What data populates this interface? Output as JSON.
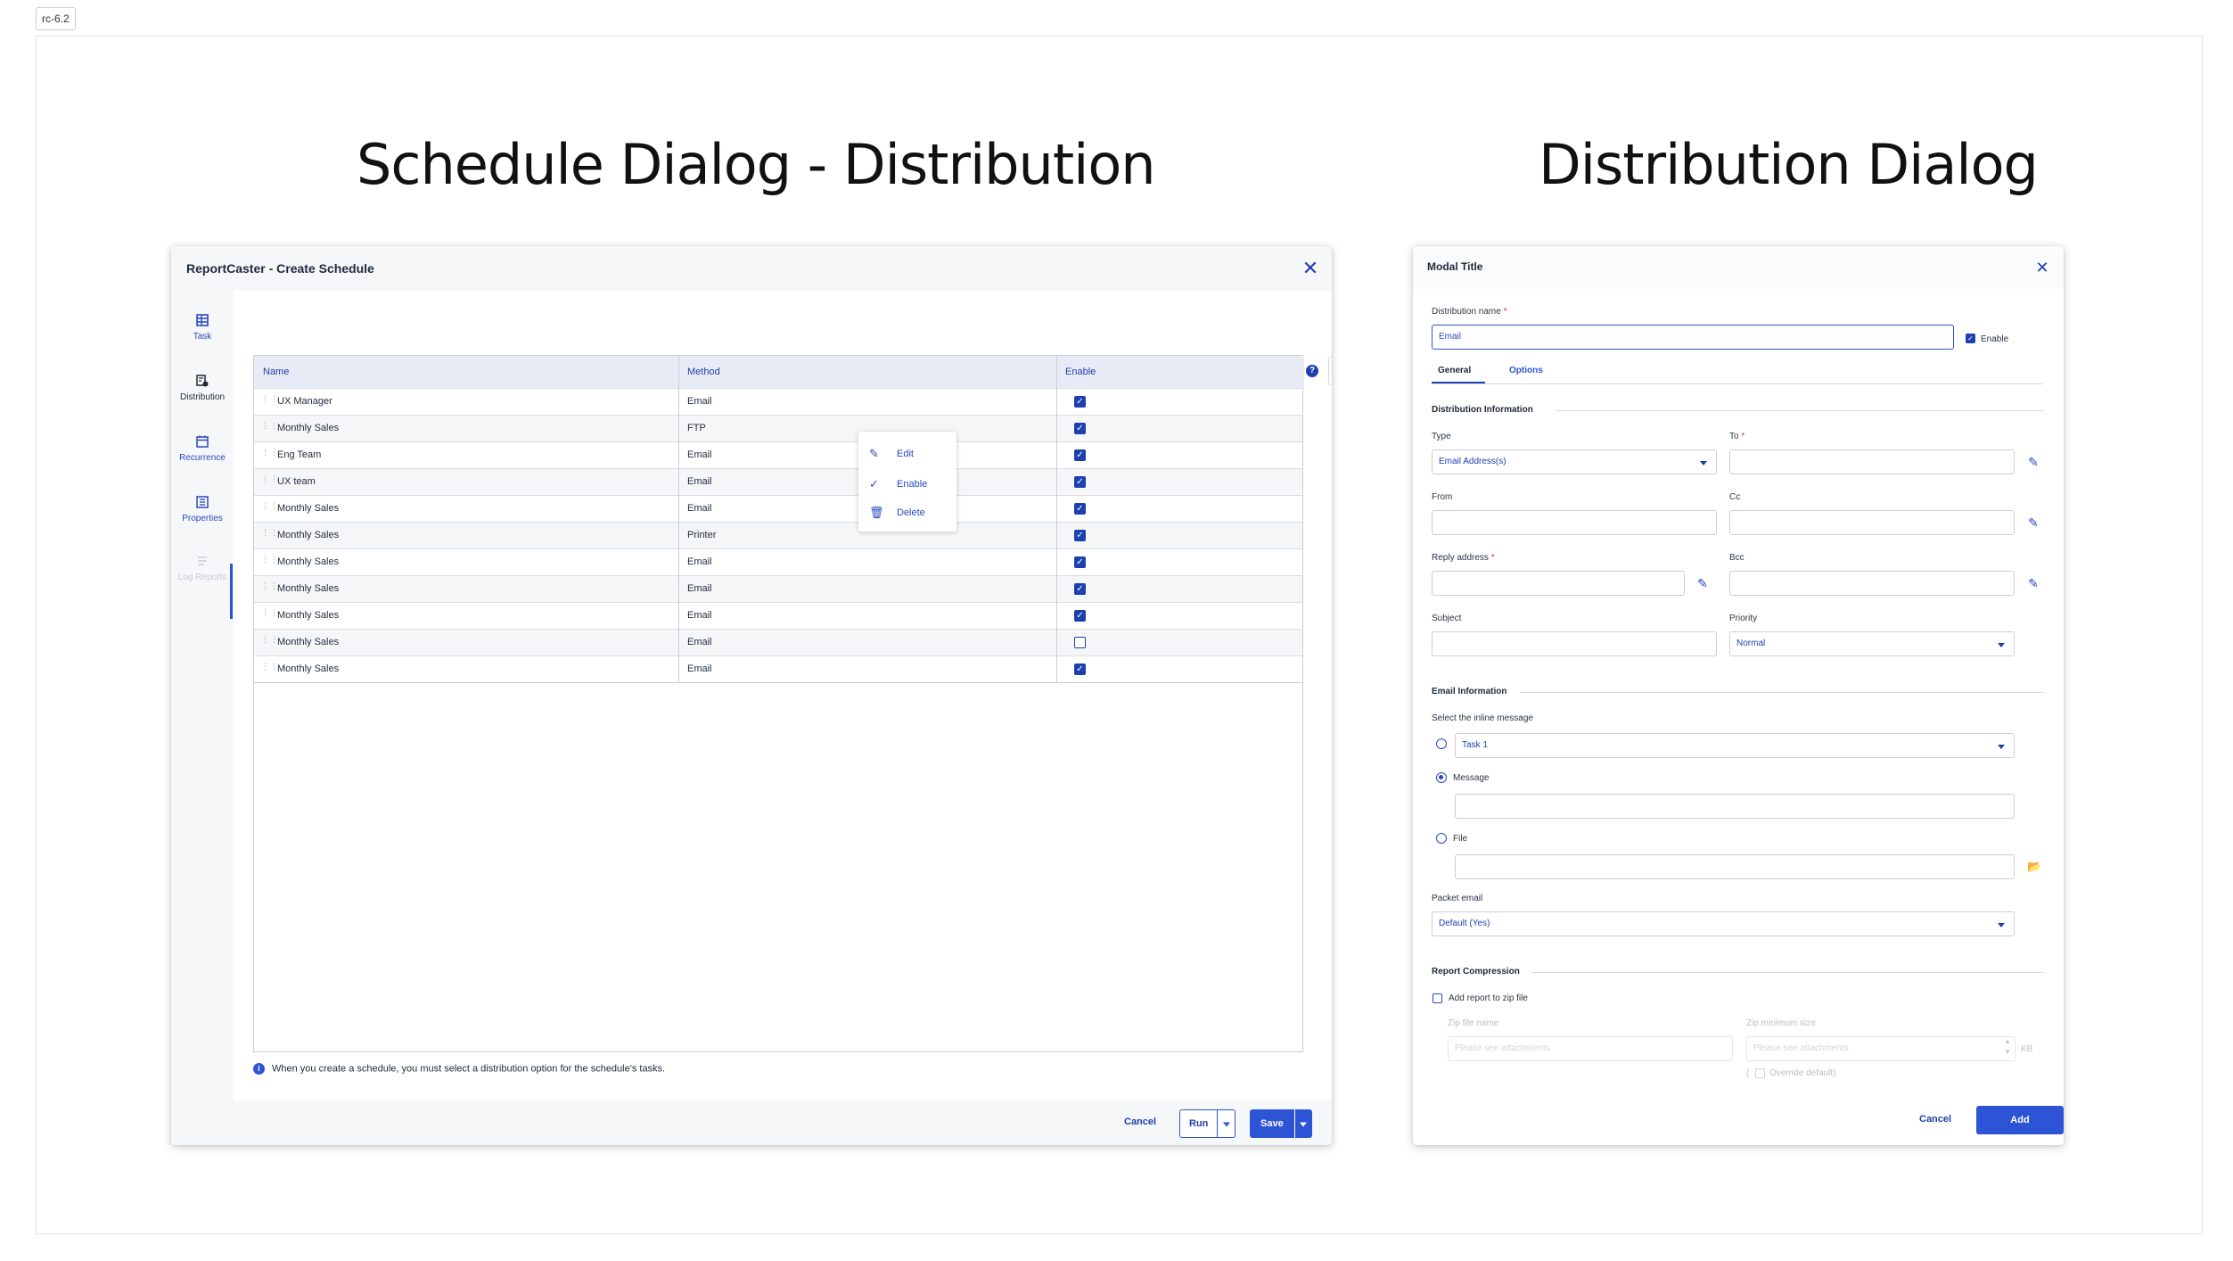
{
  "version_tag": "rc-6.2",
  "left_heading": "Schedule Dialog - Distribution",
  "right_heading": "Distribution Dialog",
  "colors": {
    "accent": "#2e54d6",
    "accent_dark": "#1e3fae",
    "required": "#d43030"
  },
  "schedule": {
    "title": "ReportCaster - Create Schedule",
    "close_icon": "close-icon",
    "sidebar": [
      {
        "label": "Task",
        "icon": "table-icon",
        "enabled": true
      },
      {
        "label": "Distribution",
        "icon": "distribution-icon",
        "enabled": true,
        "selected": true
      },
      {
        "label": "Recurrence",
        "icon": "calendar-icon",
        "enabled": true
      },
      {
        "label": "Properties",
        "icon": "properties-icon",
        "enabled": true
      },
      {
        "label": "Log Reports",
        "icon": "log-icon",
        "enabled": false
      }
    ],
    "toolbar": {
      "add": "+",
      "help": "?"
    },
    "columns": [
      "Name",
      "Method",
      "Enable"
    ],
    "rows": [
      {
        "name": "UX Manager",
        "method": "Email",
        "enabled": true
      },
      {
        "name": "Monthly Sales",
        "method": "FTP",
        "enabled": true
      },
      {
        "name": "Eng Team",
        "method": "Email",
        "enabled": true
      },
      {
        "name": "UX team",
        "method": "Email",
        "enabled": true
      },
      {
        "name": "Monthly Sales",
        "method": "Email",
        "enabled": true
      },
      {
        "name": "Monthly Sales",
        "method": "Printer",
        "enabled": true
      },
      {
        "name": "Monthly Sales",
        "method": "Email",
        "enabled": true
      },
      {
        "name": "Monthly Sales",
        "method": "Email",
        "enabled": true
      },
      {
        "name": "Monthly Sales",
        "method": "Email",
        "enabled": true
      },
      {
        "name": "Monthly Sales",
        "method": "Email",
        "enabled": false
      },
      {
        "name": "Monthly Sales",
        "method": "Email",
        "enabled": true
      }
    ],
    "context_menu": [
      {
        "label": "Edit",
        "icon": "pencil-icon"
      },
      {
        "label": "Enable",
        "icon": "check-icon"
      },
      {
        "label": "Delete",
        "icon": "trash-icon"
      }
    ],
    "info_text": "When you create a schedule, you must select a distribution option for the schedule's tasks.",
    "footer": {
      "cancel": "Cancel",
      "run": "Run",
      "save": "Save"
    }
  },
  "distribution": {
    "title": "Modal Title",
    "name_label": "Distribution name",
    "name_value": "Email",
    "enable_label": "Enable",
    "tabs": [
      "General",
      "Options"
    ],
    "distribution_info": "Distribution Information",
    "type_label": "Type",
    "type_value": "Email Address(s)",
    "to_label": "To",
    "from_label": "From",
    "cc_label": "Cc",
    "reply_label": "Reply address",
    "bcc_label": "Bcc",
    "subject_label": "Subject",
    "priority_label": "Priority",
    "priority_value": "Normal",
    "email_info": "Email Information",
    "inline_label": "Select the inline message",
    "task_value": "Task 1",
    "message_label": "Message",
    "file_label": "File",
    "packet_label": "Packet email",
    "packet_value": "Default (Yes)",
    "compression": "Report Compression",
    "zip_label": "Add report to zip file",
    "zip_name_label": "Zip file name",
    "zip_name_placeholder": "Please see attachments",
    "zip_min_label": "Zip minimum size",
    "zip_min_placeholder": "Please see attachments",
    "kb": "KB",
    "override_label": "Override default)",
    "cancel": "Cancel",
    "add": "Add"
  }
}
